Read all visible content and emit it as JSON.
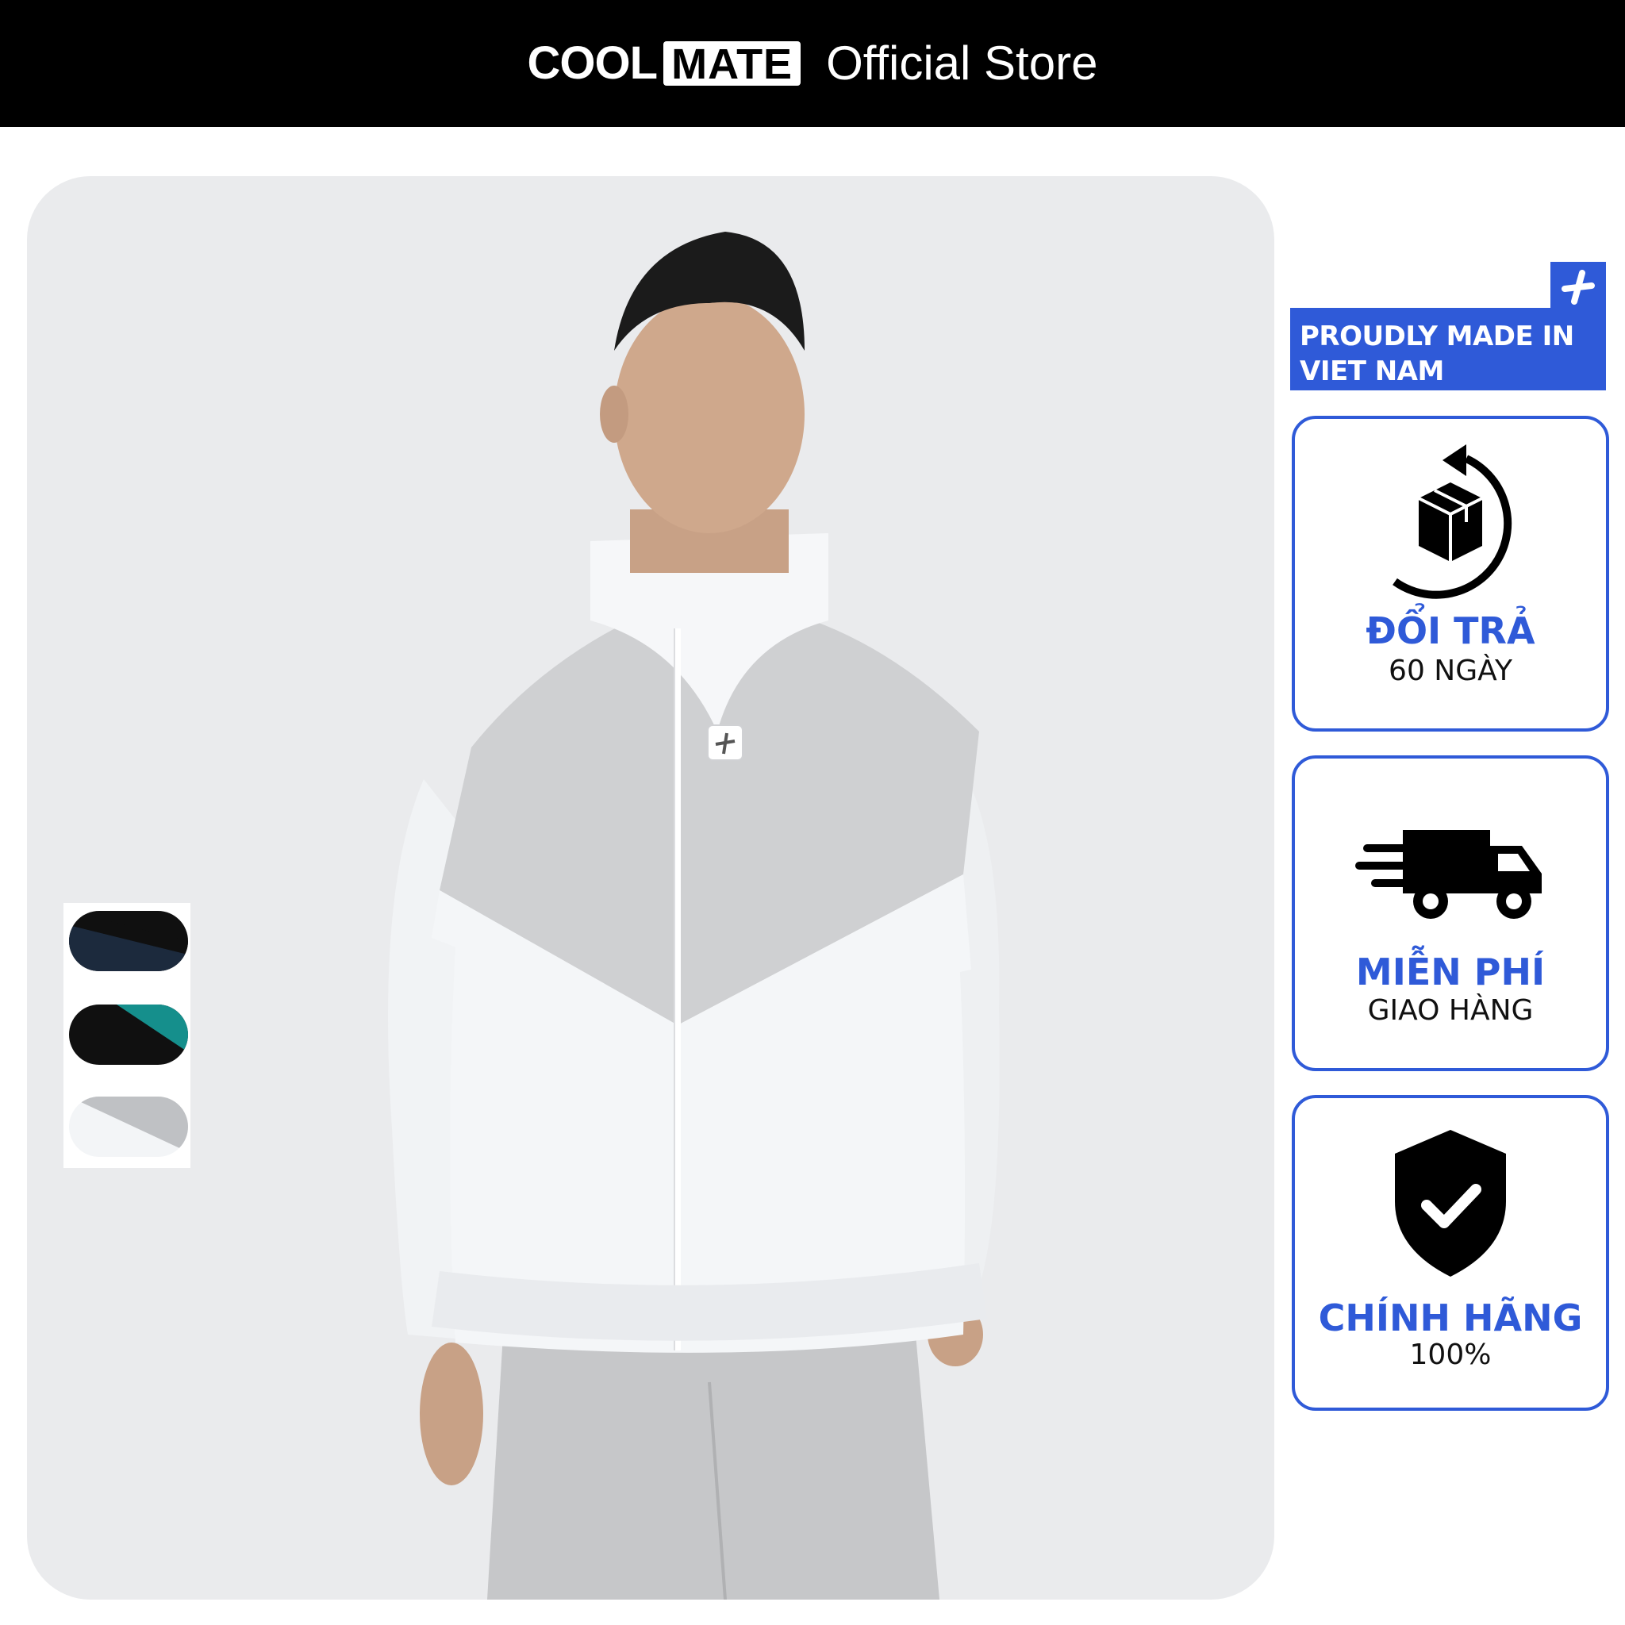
{
  "header": {
    "brand_cool": "COOL",
    "brand_mate": "MATE",
    "store_label": "Official Store"
  },
  "product": {
    "image_alt": "Model wearing white and grey windbreaker jacket",
    "swatches": [
      {
        "name": "black-navy",
        "colors": [
          "#1c2a3d",
          "#101010"
        ]
      },
      {
        "name": "black-teal",
        "colors": [
          "#101010",
          "#158f8c"
        ]
      },
      {
        "name": "white-grey",
        "colors": [
          "#f3f5f7",
          "#bfc1c4"
        ]
      }
    ]
  },
  "badges": {
    "made_in": "PROUDLY MADE IN VIET NAM",
    "returns": {
      "title": "ĐỔI TRẢ",
      "subtitle": "60 NGÀY",
      "icon": "return-box-icon"
    },
    "shipping": {
      "title": "MIỄN PHÍ",
      "subtitle": "GIAO HÀNG",
      "icon": "delivery-truck-icon"
    },
    "authentic": {
      "title": "CHÍNH HÃNG",
      "subtitle": "100%",
      "icon": "shield-check-icon"
    }
  },
  "colors": {
    "header_bg": "#000000",
    "accent_blue": "#2f5ad8",
    "card_bg": "#eaebed"
  }
}
